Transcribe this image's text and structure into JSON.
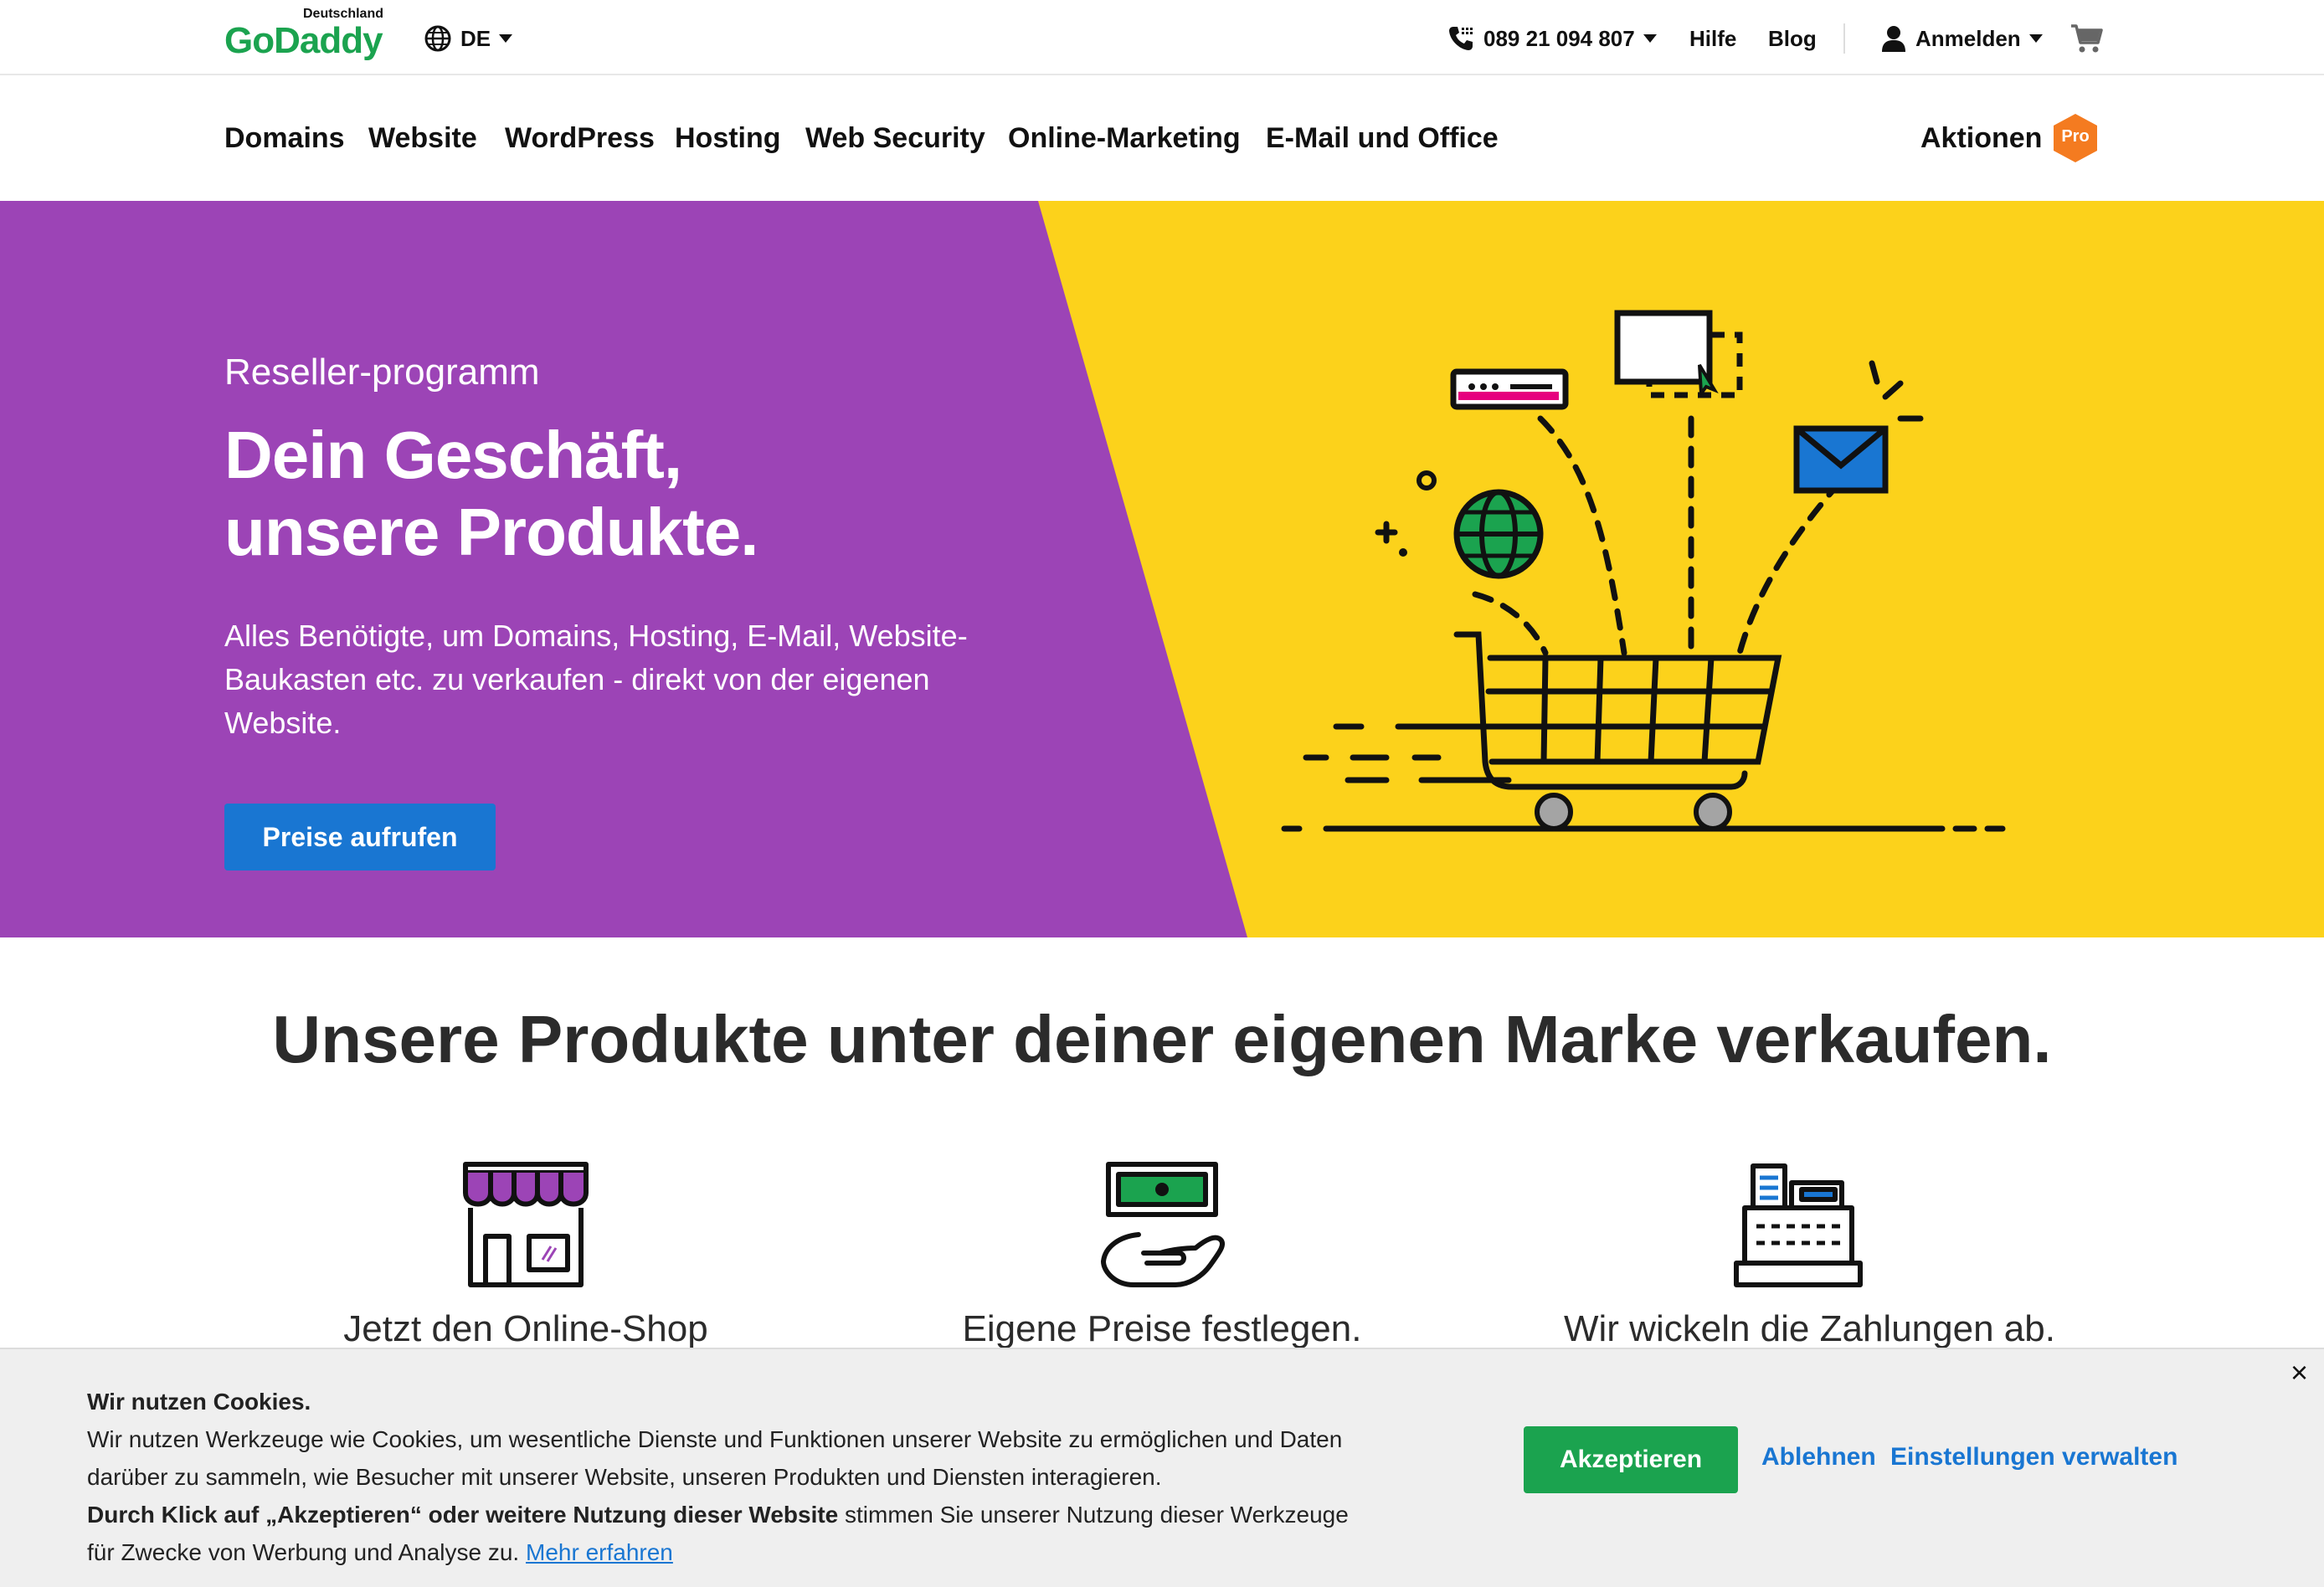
{
  "header": {
    "logo_sub": "Deutschland",
    "logo_text": "GoDaddy",
    "language": "DE",
    "phone": "089 21 094 807",
    "help": "Hilfe",
    "blog": "Blog",
    "signin": "Anmelden"
  },
  "nav": {
    "items": [
      "Domains",
      "Website",
      "WordPress",
      "Hosting",
      "Web Security",
      "Online-Marketing",
      "E-Mail und Office"
    ],
    "promotions": "Aktionen",
    "pro_badge": "Pro"
  },
  "hero": {
    "eyebrow": "Reseller-programm",
    "title_line1": "Dein Geschäft,",
    "title_line2": "unsere Produkte.",
    "description": "Alles Benötigte, um Domains, Hosting, E-Mail, Website-Baukasten etc. zu verkaufen - direkt von der eigenen Website.",
    "cta": "Preise aufrufen"
  },
  "section": {
    "title": "Unsere Produkte unter deiner eigenen Marke verkaufen.",
    "features": [
      {
        "title": "Jetzt den Online-Shop",
        "icon": "storefront-icon"
      },
      {
        "title": "Eigene Preise festlegen.",
        "icon": "money-hand-icon"
      },
      {
        "title": "Wir wickeln die Zahlungen ab.",
        "icon": "cash-register-icon"
      }
    ]
  },
  "cookie": {
    "heading": "Wir nutzen Cookies.",
    "body1": "Wir nutzen Werkzeuge wie Cookies, um wesentliche Dienste und Funktionen unserer Website zu ermöglichen und Daten darüber zu sammeln, wie Besucher mit unserer Website, unseren Produkten und Diensten interagieren.",
    "bold": "Durch Klick auf „Akzeptieren“ oder weitere Nutzung dieser Website",
    "body2": " stimmen Sie unserer Nutzung dieser Werkzeuge für Zwecke von Werbung und Analyse zu. ",
    "more_link": "Mehr erfahren",
    "accept": "Akzeptieren",
    "decline": "Ablehnen",
    "settings": "Einstellungen verwalten",
    "close": "×"
  },
  "colors": {
    "hero_purple": "#9c44b6",
    "hero_yellow": "#fcd21b",
    "primary_blue": "#1976d2",
    "accept_green": "#1ba34f",
    "logo_green": "#1ba34f",
    "pro_orange": "#f47b20"
  }
}
